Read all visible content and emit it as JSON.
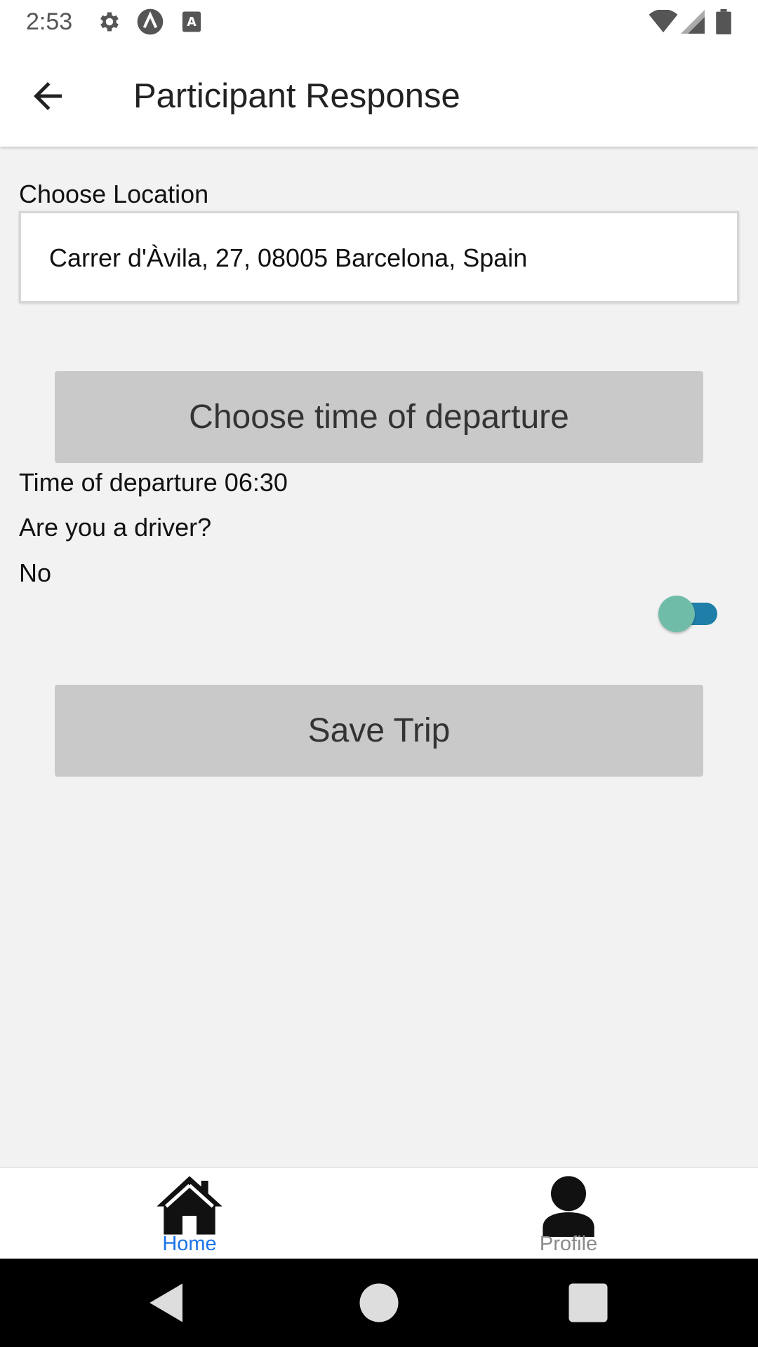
{
  "status_bar": {
    "time": "2:53",
    "icons": [
      "gear-icon",
      "app-logo-icon",
      "keyboard-a-icon",
      "wifi-icon",
      "signal-icon",
      "battery-icon"
    ]
  },
  "app_bar": {
    "title": "Participant Response",
    "back_icon": "arrow-left-icon"
  },
  "form": {
    "location_label": "Choose Location",
    "location_value": "Carrer d'Àvila, 27, 08005 Barcelona, Spain",
    "departure_button": "Choose time of departure",
    "departure_time_text": "Time of departure 06:30",
    "driver_question": "Are you a driver?",
    "driver_answer": "No",
    "save_button": "Save Trip",
    "toggle_colors": {
      "track": "#1f7fa8",
      "thumb": "#6fbda9"
    }
  },
  "bottom_nav": {
    "items": [
      {
        "label": "Home",
        "icon": "home-icon",
        "active": true,
        "color": "#1a73e8"
      },
      {
        "label": "Profile",
        "icon": "person-icon",
        "active": false,
        "color": "#8a8a8a"
      }
    ]
  },
  "system_nav": {
    "buttons": [
      "back-triangle-icon",
      "home-circle-icon",
      "recents-square-icon"
    ]
  }
}
